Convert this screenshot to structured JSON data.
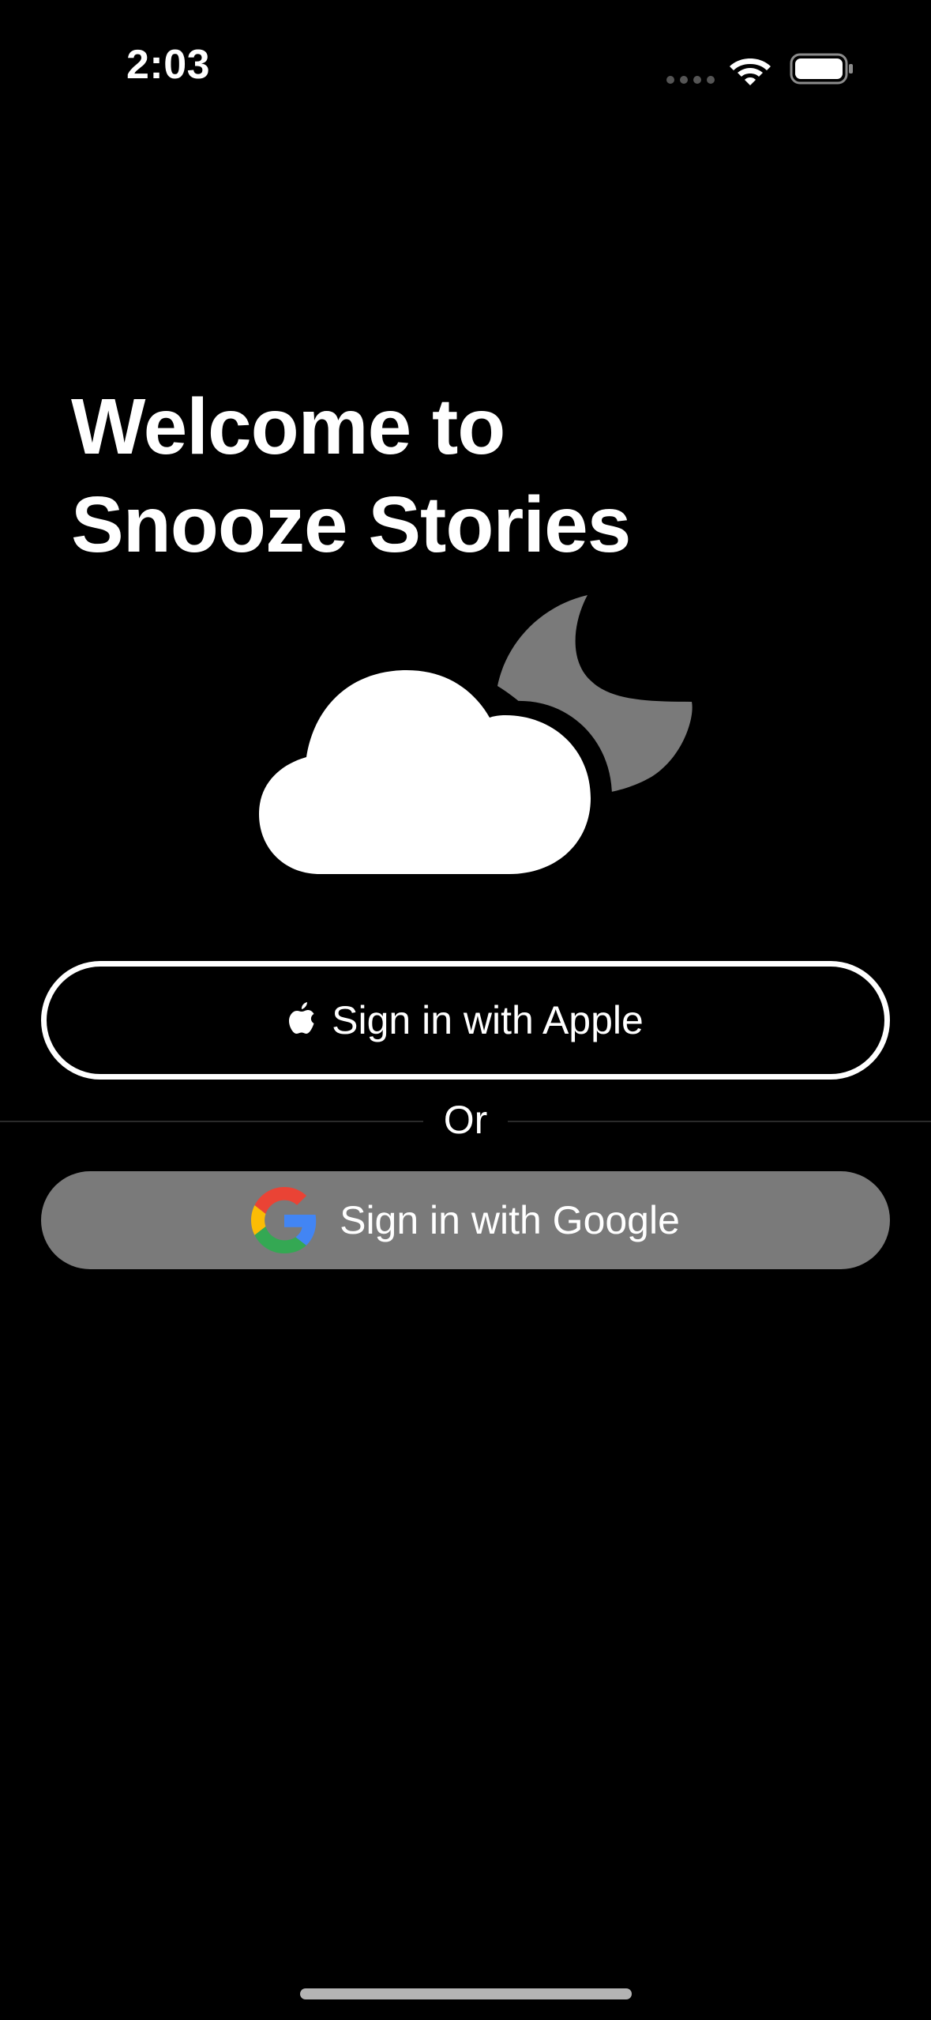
{
  "status_bar": {
    "time": "2:03",
    "signal_icon": "cellular-dots-icon",
    "wifi_icon": "wifi-icon",
    "battery_icon": "battery-icon"
  },
  "welcome": {
    "title_line1": "Welcome to",
    "title_line2": "Snooze Stories"
  },
  "illustration": {
    "icon": "cloud-moon-icon",
    "cloud_color": "#ffffff",
    "moon_color": "#7a7a7a"
  },
  "auth": {
    "apple_button_label": "Sign in with Apple",
    "apple_icon": "apple-logo-icon",
    "divider_text": "Or",
    "google_button_label": "Sign in with Google",
    "google_icon": "google-logo-icon",
    "google_button_color": "#7a7a7a"
  },
  "colors": {
    "background": "#000000",
    "text": "#ffffff"
  }
}
